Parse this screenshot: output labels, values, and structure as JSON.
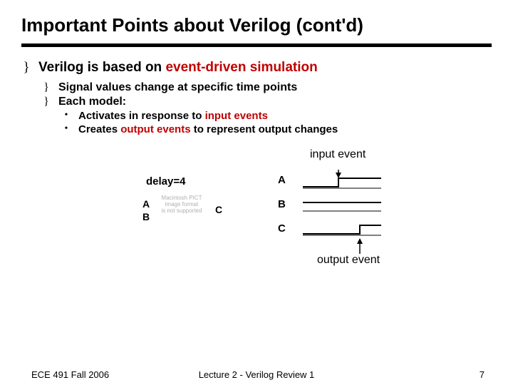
{
  "title": "Important Points about Verilog (cont'd)",
  "l1": {
    "pre": "Verilog is based on ",
    "red": "event-driven simulation"
  },
  "l2a": "Signal values change at specific time points",
  "l2b": "Each model:",
  "l3a": {
    "pre": "Activates in response to ",
    "red": "input events"
  },
  "l3b": {
    "pre": "Creates ",
    "red": "output events",
    "post": " to represent output changes"
  },
  "diagram": {
    "delay": "delay=4",
    "A": "A",
    "B": "B",
    "C": "C",
    "input_event": "input event",
    "output_event": "output event",
    "wA": "A",
    "wB": "B",
    "wC": "C",
    "pict1": "Macintosh PICT",
    "pict2": "image format",
    "pict3": "is not supported"
  },
  "footer": {
    "left": "ECE 491 Fall 2006",
    "center": "Lecture 2 - Verilog Review 1",
    "page": "7"
  }
}
